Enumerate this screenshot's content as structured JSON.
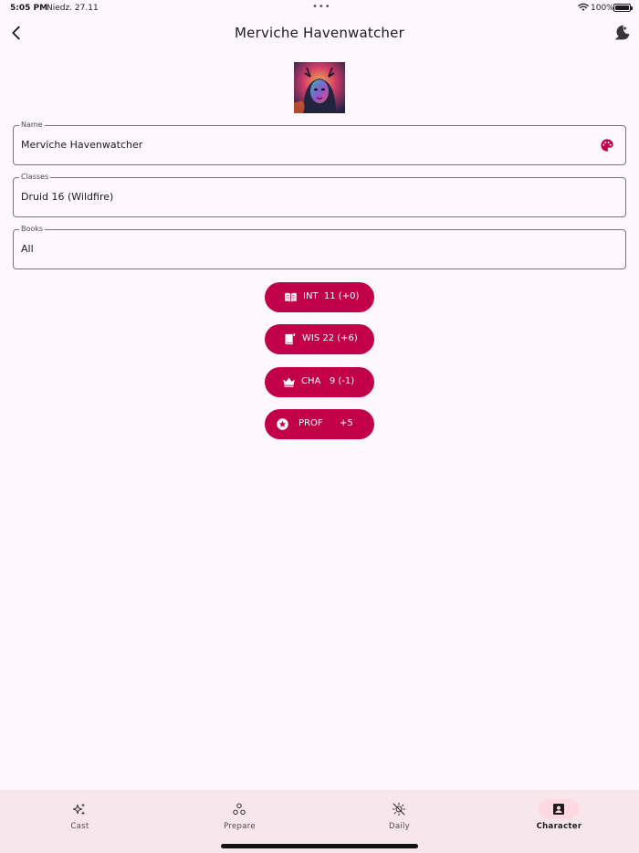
{
  "status_bar": {
    "time": "5:05 PM",
    "date": "Niedz. 27.11",
    "dots": "•••",
    "battery_percent": "100%",
    "battery_level": 1.0
  },
  "app_bar": {
    "title": "Merviche Havenwatcher",
    "back_icon": "chevron-left-icon",
    "theme_icon": "dark-mode-icon"
  },
  "avatar": {
    "icon": "character-portrait"
  },
  "form": {
    "name": {
      "label": "Name",
      "value": "Merviche Havenwatcher",
      "icon": "palette-icon"
    },
    "classes": {
      "label": "Classes",
      "value": "Druid 16 (Wildfire)"
    },
    "books": {
      "label": "Books",
      "value": "All"
    }
  },
  "stats": {
    "int": {
      "text": "INT  11 (+0)",
      "icon": "book-open-icon"
    },
    "wis": {
      "text": "WIS 22 (+6)",
      "icon": "book-bookmark-icon"
    },
    "cha": {
      "text": "CHA   9 (-1)",
      "icon": "crown-icon"
    },
    "prof": {
      "label": "PROF",
      "value": "+5",
      "icon": "star-circle-icon"
    }
  },
  "bottom_nav": {
    "items": [
      {
        "label": "Cast",
        "icon": "sparkles-icon",
        "active": false
      },
      {
        "label": "Prepare",
        "icon": "circles-icon",
        "active": false
      },
      {
        "label": "Daily",
        "icon": "sun-off-icon",
        "active": false
      },
      {
        "label": "Character",
        "icon": "account-box-icon",
        "active": true
      }
    ]
  },
  "colors": {
    "accent": "#c2004a",
    "background": "#fef7fb",
    "nav_background": "#f7e6ec",
    "nav_active_pill": "#ffd9e1"
  }
}
